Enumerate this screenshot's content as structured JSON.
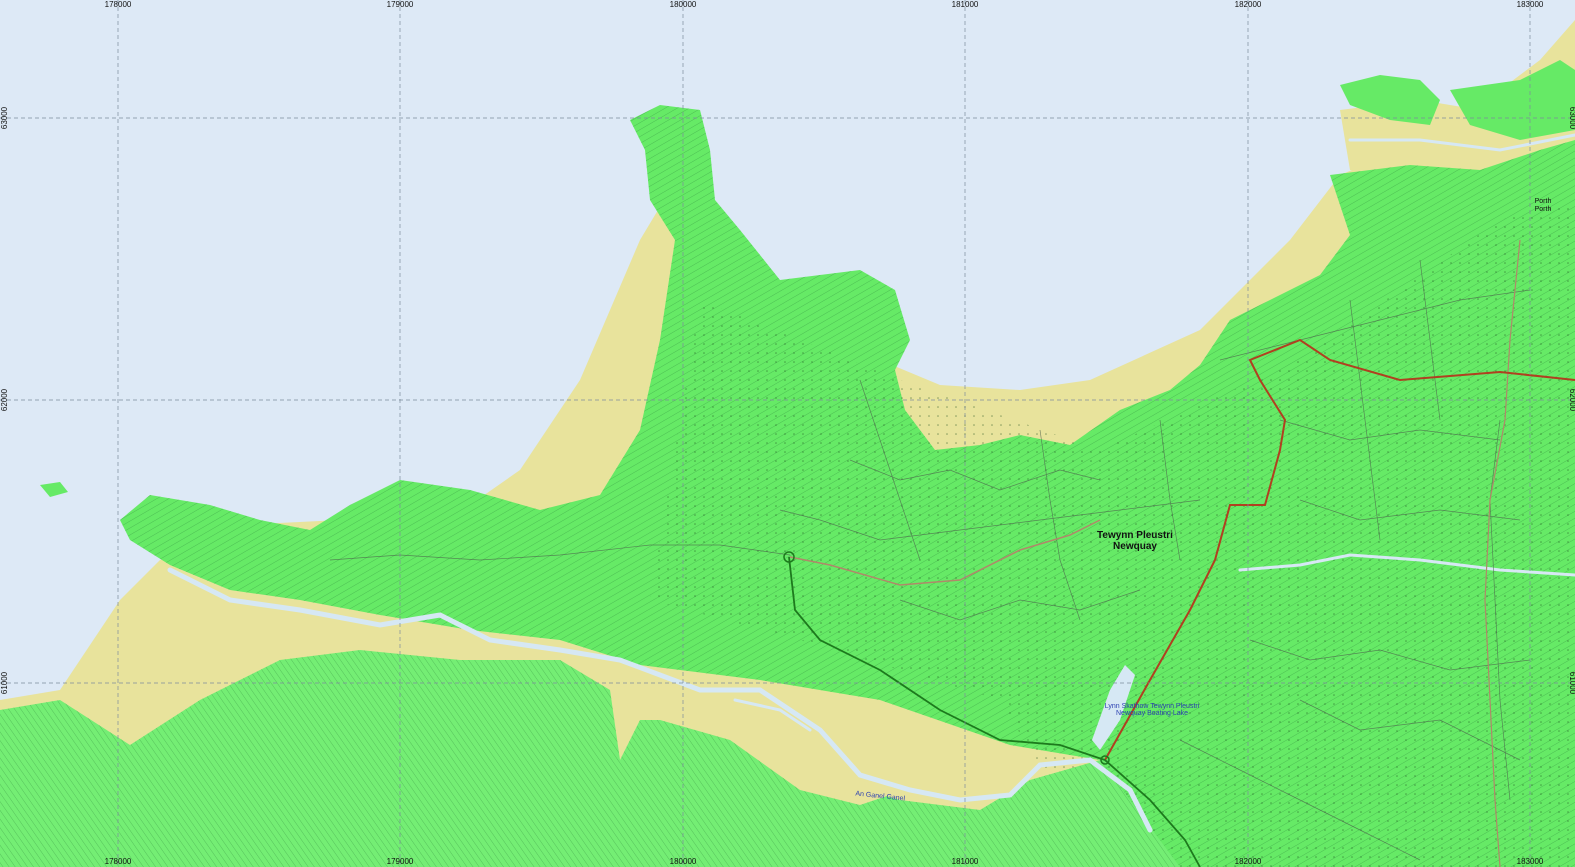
{
  "map": {
    "colors": {
      "sea": "#dde9f6",
      "sand": "#e8e39c",
      "land": "#66ea66",
      "land_light": "#7df27d",
      "road": "#5a6a5a",
      "main_road": "#b04020",
      "railway": "#1d7a1d",
      "river": "#d6e8f4",
      "grid": "#7c8c9c"
    },
    "easting_labels": [
      "178000",
      "179000",
      "180000",
      "181000",
      "182000",
      "183000"
    ],
    "northing_labels": [
      "63000",
      "62000",
      "61000"
    ],
    "places": {
      "town_cornish": "Tewynn Pleustri",
      "town_english": "Newquay",
      "porth_cornish": "Porth",
      "porth_english": "Porth",
      "lake_line1": "Lynn Skathow Tewynn Pleustri",
      "lake_line2": "Newquay Boating Lake",
      "river_name": "An Ganel Ganel"
    }
  }
}
